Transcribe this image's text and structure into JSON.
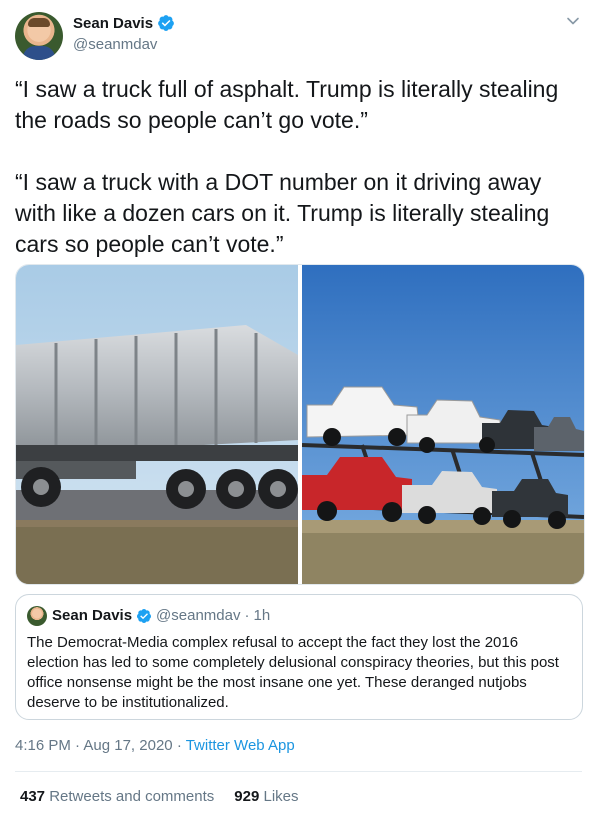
{
  "author": {
    "name": "Sean Davis",
    "handle": "@seanmdav"
  },
  "tweet": {
    "text": "“I saw a truck full of asphalt. Trump is literally stealing the roads so people can’t go vote.”\n\n“I saw a truck with a DOT number on it driving away with like a dozen cars on it. Trump is literally stealing cars so people can’t vote.”"
  },
  "media": {
    "left_photo": "asphalt-dump-truck-photo",
    "right_photo": "car-carrier-truck-photo"
  },
  "quoted": {
    "name": "Sean Davis",
    "handle": "@seanmdav",
    "dot": "·",
    "time": "1h",
    "text": "The Democrat-Media complex refusal to accept the fact they lost the 2016 election has led to some completely delusional conspiracy theories, but this post office nonsense might be the most insane one yet. These deranged nutjobs deserve to be institutionalized."
  },
  "meta": {
    "time": "4:16 PM",
    "sep1": "·",
    "date": "Aug 17, 2020",
    "sep2": "·",
    "app": "Twitter Web App"
  },
  "stats": {
    "retweets_count": "437",
    "retweets_label": "Retweets and comments",
    "likes_count": "929",
    "likes_label": "Likes"
  },
  "colors": {
    "link": "#1b95e0",
    "verified": "#1da1f2",
    "secondary_text": "#657786"
  }
}
